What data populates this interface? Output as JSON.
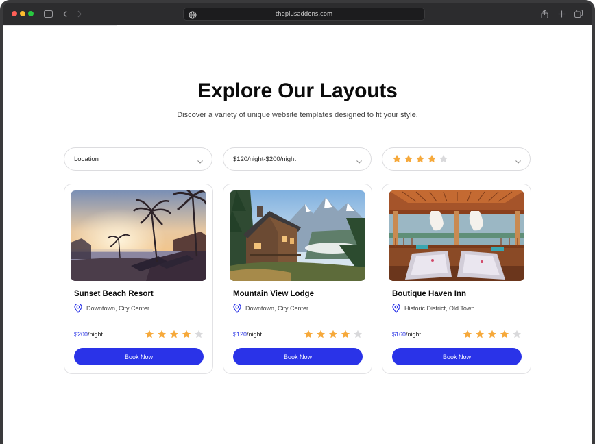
{
  "browser": {
    "url": "theplusaddons.com",
    "icons": [
      "sidebar-icon",
      "back-icon",
      "forward-icon",
      "globe-icon",
      "share-icon",
      "new-tab-icon",
      "tabs-overview-icon"
    ]
  },
  "page": {
    "title": "Explore Our Layouts",
    "subtitle": "Discover a variety of unique website templates designed to fit your style."
  },
  "filters": {
    "location": "Location",
    "price": "$120/night-$200/night",
    "rating": {
      "value": 4,
      "max": 5
    }
  },
  "colors": {
    "accent": "#2a33e8",
    "star_filled": "#f6a93b",
    "star_empty": "#d9d9db"
  },
  "cards": [
    {
      "name": "Sunset Beach Resort",
      "location": "Downtown, City Center",
      "price": "$200",
      "per": "/night",
      "rating": 4,
      "button": "Book Now",
      "image": "beach-resort-photo"
    },
    {
      "name": "Mountain View Lodge",
      "location": "Downtown, City Center",
      "price": "$120",
      "per": "/night",
      "rating": 4,
      "button": "Book Now",
      "image": "mountain-lodge-photo"
    },
    {
      "name": "Boutique Haven Inn",
      "location": "Historic District, Old Town",
      "price": "$160",
      "per": "/night",
      "rating": 4,
      "button": "Book Now",
      "image": "spa-pavilion-photo"
    }
  ]
}
